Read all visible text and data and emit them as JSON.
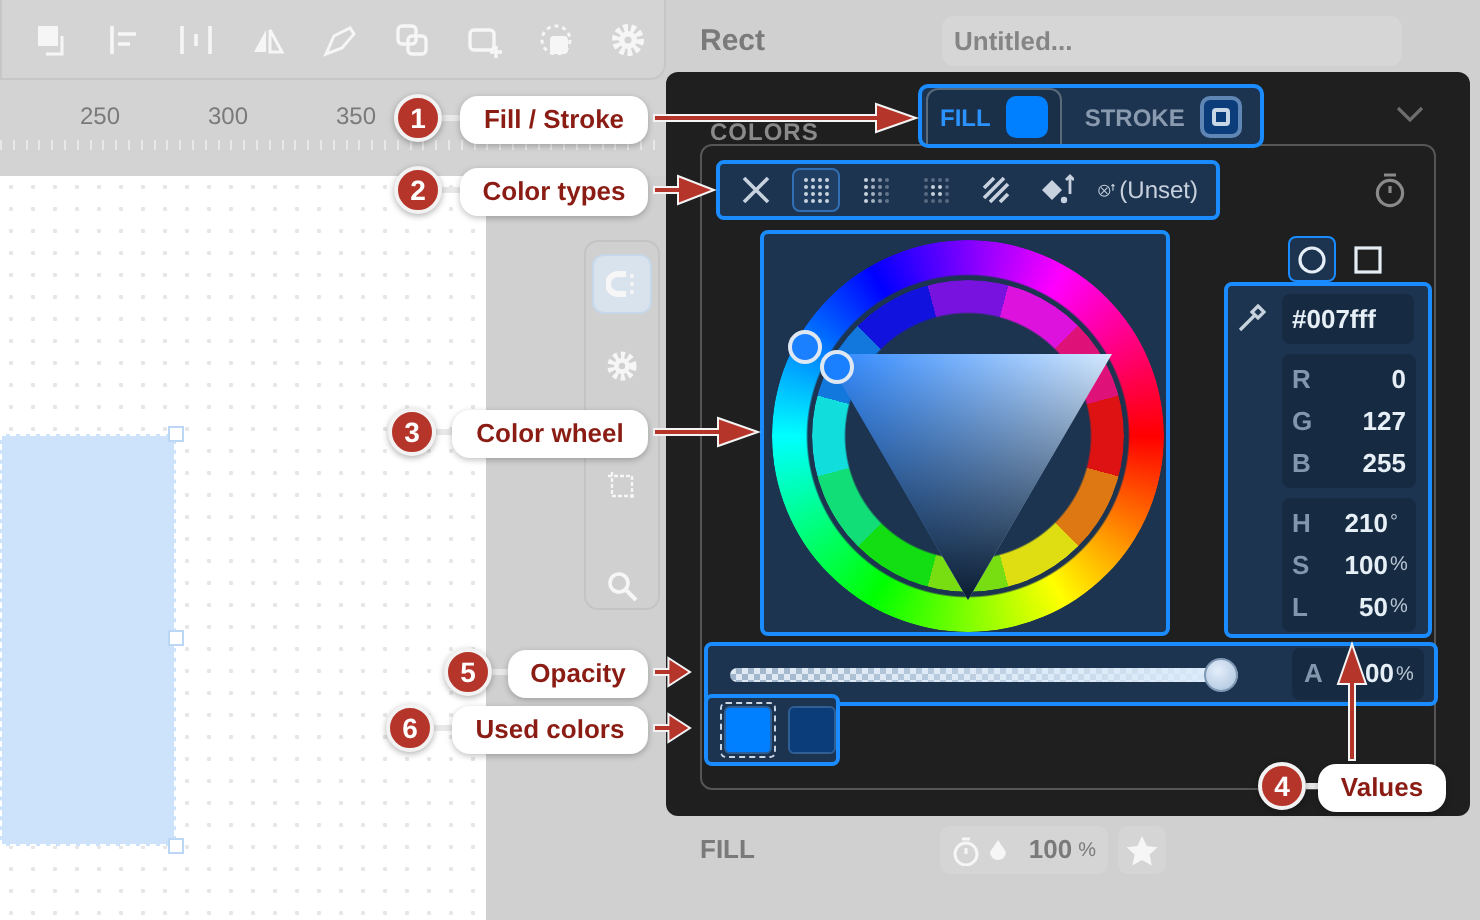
{
  "ruler": {
    "labels": [
      "250",
      "300",
      "350"
    ]
  },
  "sidebar": {
    "title": "Rect",
    "name_field": {
      "placeholder": "Untitled..."
    },
    "fill_row": {
      "label": "FILL",
      "opacity": "100",
      "unit": "%"
    }
  },
  "color_popup": {
    "section_label": "COLORS",
    "tabs": [
      {
        "label": "FILL",
        "selected": true,
        "color": "#007fff"
      },
      {
        "label": "STROKE",
        "selected": false,
        "color": "#0a3d7a"
      }
    ],
    "color_types": [
      {
        "kind": "none",
        "selected": false
      },
      {
        "kind": "solid",
        "selected": true
      },
      {
        "kind": "linear",
        "selected": false
      },
      {
        "kind": "radial",
        "selected": false
      },
      {
        "kind": "pattern",
        "selected": false
      },
      {
        "kind": "inherit",
        "selected": false
      },
      {
        "kind": "unset",
        "selected": false,
        "label": "(Unset)"
      }
    ],
    "shape_toggle": [
      {
        "kind": "circle",
        "selected": true
      },
      {
        "kind": "square",
        "selected": false
      }
    ],
    "hex": "#007fff",
    "rgb": [
      {
        "label": "R",
        "value": "0"
      },
      {
        "label": "G",
        "value": "127"
      },
      {
        "label": "B",
        "value": "255"
      }
    ],
    "hsl": [
      {
        "label": "H",
        "value": "210",
        "unit": "°"
      },
      {
        "label": "S",
        "value": "100",
        "unit": "%"
      },
      {
        "label": "L",
        "value": "50",
        "unit": "%"
      }
    ],
    "opacity": {
      "level": 1,
      "label": "A",
      "value": "00",
      "unit": "%"
    },
    "used_colors": [
      {
        "color": "#007fff",
        "selected": true
      },
      {
        "color": "#0a3d7a",
        "selected": false
      }
    ]
  },
  "annotations": [
    {
      "number": "1",
      "label": "Fill / Stroke"
    },
    {
      "number": "2",
      "label": "Color types"
    },
    {
      "number": "3",
      "label": "Color wheel"
    },
    {
      "number": "4",
      "label": "Values"
    },
    {
      "number": "5",
      "label": "Opacity"
    },
    {
      "number": "6",
      "label": "Used colors"
    }
  ]
}
